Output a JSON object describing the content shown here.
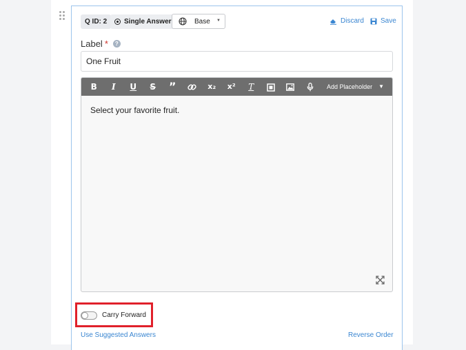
{
  "question": {
    "id_label": "Q ID: 2",
    "type_label": "Single Answer",
    "language": {
      "selected": "Base"
    },
    "actions": {
      "discard": "Discard",
      "save": "Save"
    }
  },
  "label_field": {
    "label": "Label",
    "required_marker": "*",
    "help_glyph": "?",
    "value": "One Fruit"
  },
  "editor": {
    "toolbar": {
      "bold": "B",
      "italic": "I",
      "underline": "U",
      "strike": "S",
      "quote": "”",
      "subscript": "x₂",
      "superscript": "x²",
      "clear_format": "T",
      "add_placeholder": "Add Placeholder",
      "add_placeholder_caret": "▼",
      "icons": [
        "link-icon",
        "video-icon",
        "image-icon",
        "microphone-icon"
      ]
    },
    "content": "Select your favorite fruit."
  },
  "carry_forward": {
    "label": "Carry Forward",
    "enabled": false
  },
  "footer": {
    "use_suggested": "Use Suggested Answers",
    "reverse_order": "Reverse Order"
  },
  "colors": {
    "accent_link": "#3a86d1",
    "card_border": "#9cc4ec",
    "toolbar_bg": "#6e6e6e",
    "required": "#d0342c",
    "highlight": "#e0202a"
  }
}
